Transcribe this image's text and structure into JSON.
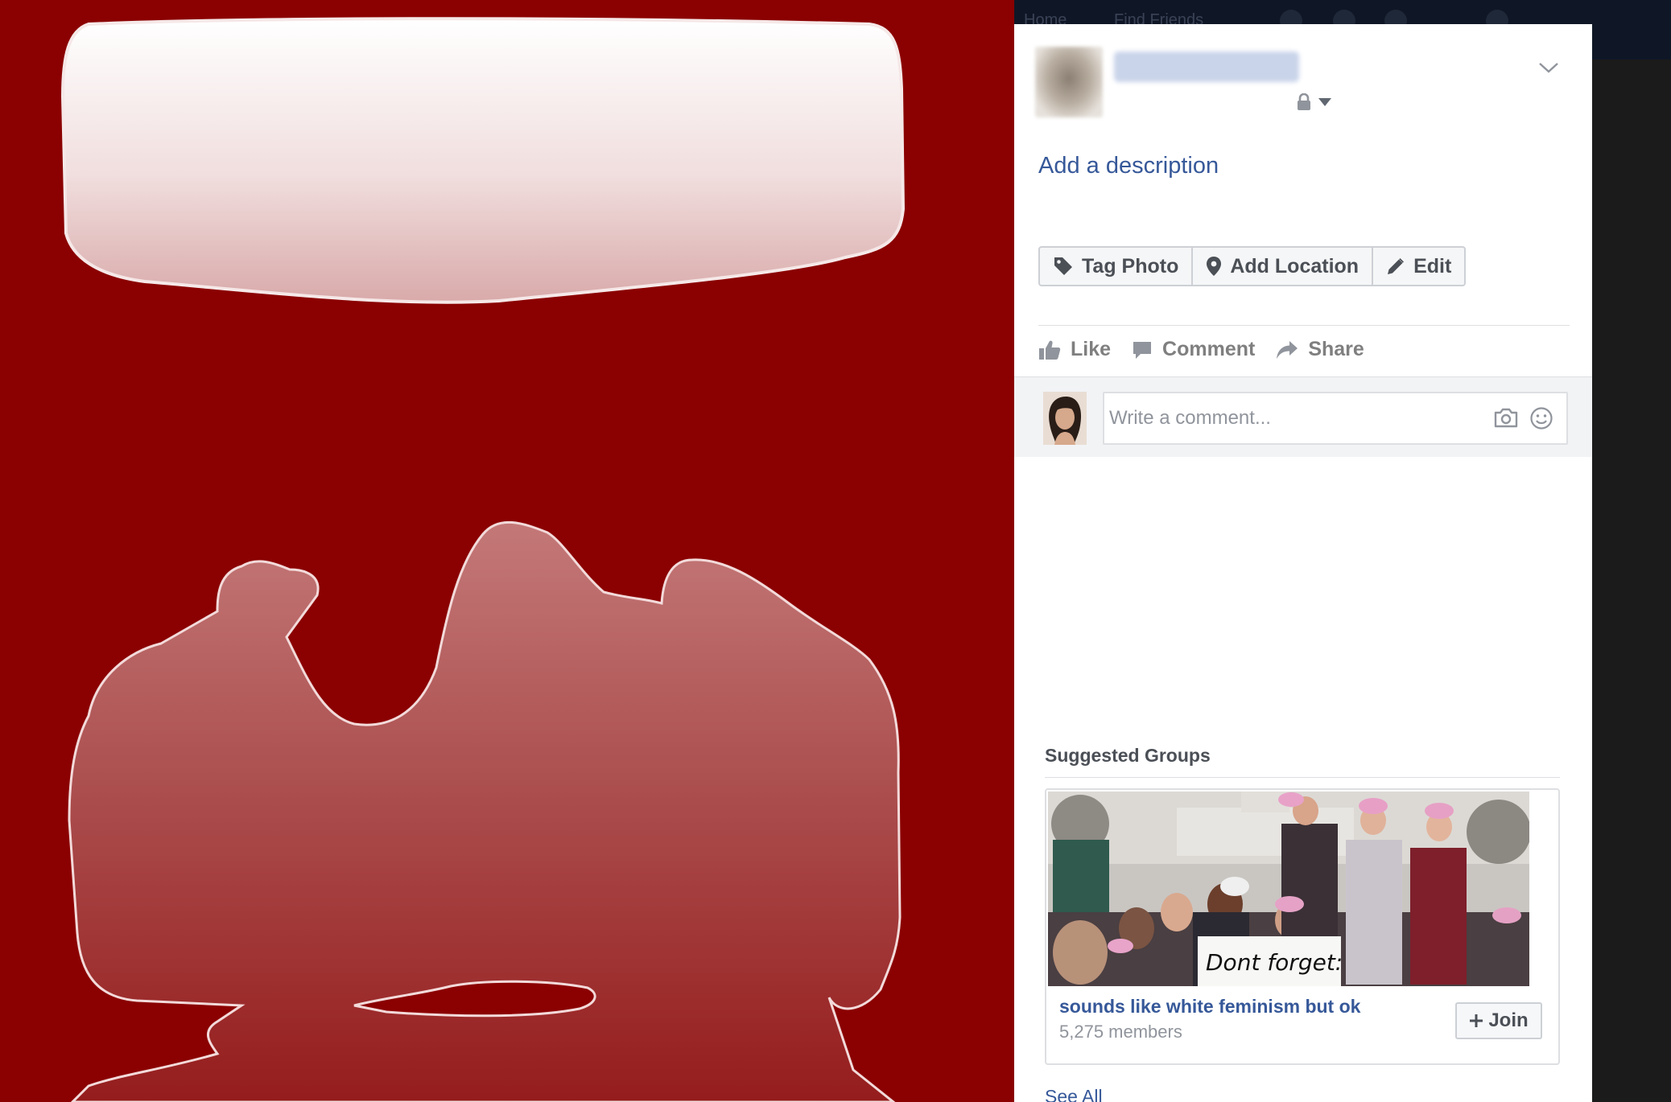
{
  "topbar": {
    "links": [
      "Home",
      "Find Friends"
    ]
  },
  "photo_post": {
    "privacy_icon": "lock-icon",
    "add_description_label": "Add a description",
    "actions": [
      {
        "label": "Tag Photo",
        "icon": "tag-icon"
      },
      {
        "label": "Add Location",
        "icon": "location-pin-icon"
      },
      {
        "label": "Edit",
        "icon": "pencil-icon"
      }
    ],
    "ufi": [
      {
        "label": "Like",
        "icon": "thumbs-up-icon"
      },
      {
        "label": "Comment",
        "icon": "comment-bubble-icon"
      },
      {
        "label": "Share",
        "icon": "share-arrow-icon"
      }
    ],
    "comment_placeholder": "Write a comment..."
  },
  "suggested_groups": {
    "title": "Suggested Groups",
    "groups": [
      {
        "name": "sounds like white feminism but ok",
        "members": "5,275 members",
        "join_label": "Join",
        "photo_sign_text": "Dont forget:"
      }
    ],
    "see_all_label": "See All"
  },
  "colors": {
    "photo_background": "#8b0000",
    "link_blue": "#365899",
    "panel_background": "#ffffff",
    "topbar": "#0f1726"
  }
}
